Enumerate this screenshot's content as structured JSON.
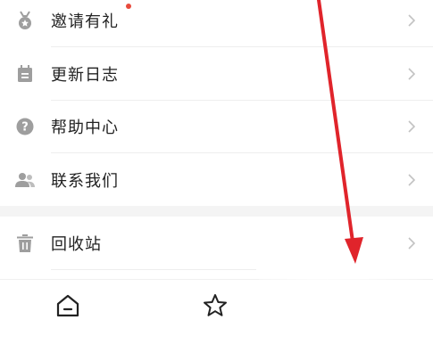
{
  "menu": {
    "items": [
      {
        "label": "邀请有礼",
        "icon": "medal-icon",
        "badge_dot": true
      },
      {
        "label": "更新日志",
        "icon": "calendar-icon"
      },
      {
        "label": "帮助中心",
        "icon": "help-icon"
      },
      {
        "label": "联系我们",
        "icon": "people-icon"
      },
      {
        "label": "回收站",
        "icon": "trash-icon"
      }
    ]
  },
  "bottom_nav": {
    "items": [
      {
        "icon": "home-icon"
      },
      {
        "icon": "star-icon"
      }
    ]
  },
  "colors": {
    "icon_gray": "#9e9e9e",
    "chevron_gray": "#c2c2c2",
    "badge_red": "#e84a3c",
    "arrow_red": "#e0242b",
    "text": "#222222"
  }
}
